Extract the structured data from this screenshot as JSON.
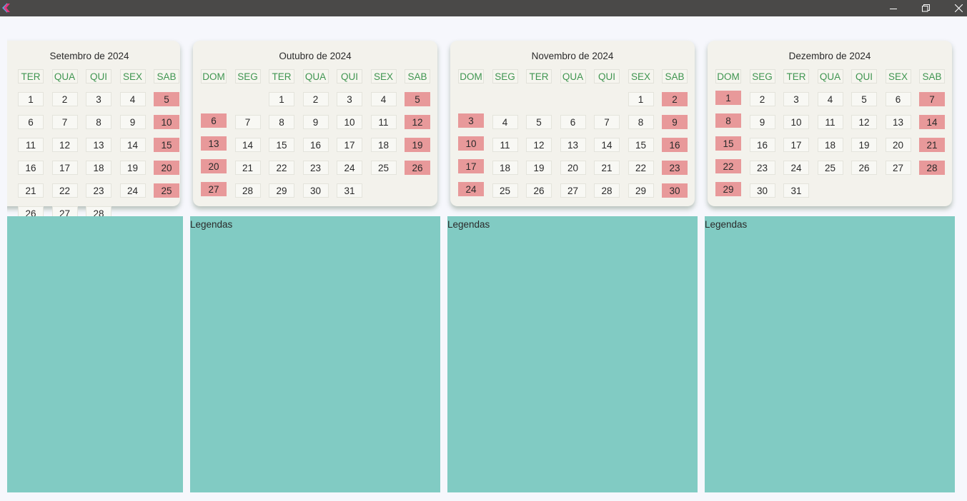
{
  "window": {
    "controls": [
      "minimize",
      "restore",
      "close"
    ],
    "app_icon": "app-logo-icon"
  },
  "colors": {
    "titlebar": "#4a4948",
    "background": "#f6f7fc",
    "card": "#f3f2ec",
    "weekday_text": "#3f9550",
    "weekend_highlight": "#e8999a",
    "panel": "#81cbc3"
  },
  "months": [
    {
      "title": "Setembro de 2024",
      "weekdays": [
        "TER",
        "QUA",
        "QUI",
        "SEX",
        "SAB"
      ],
      "first_col": 0,
      "days": 28
    },
    {
      "title": "Outubro de 2024",
      "weekdays": [
        "DOM",
        "SEG",
        "TER",
        "QUA",
        "QUI",
        "SEX",
        "SAB"
      ],
      "first_col": 2,
      "days": 31
    },
    {
      "title": "Novembro de 2024",
      "weekdays": [
        "DOM",
        "SEG",
        "TER",
        "QUA",
        "QUI",
        "SEX",
        "SAB"
      ],
      "first_col": 5,
      "days": 30
    },
    {
      "title": "Dezembro de 2024",
      "weekdays": [
        "DOM",
        "SEG",
        "TER",
        "QUA",
        "QUI",
        "SEX",
        "SAB"
      ],
      "first_col": 0,
      "days": 31
    }
  ],
  "panels": [
    {
      "label": ""
    },
    {
      "label": "Legendas"
    },
    {
      "label": "Legendas"
    },
    {
      "label": "Legendas"
    }
  ]
}
